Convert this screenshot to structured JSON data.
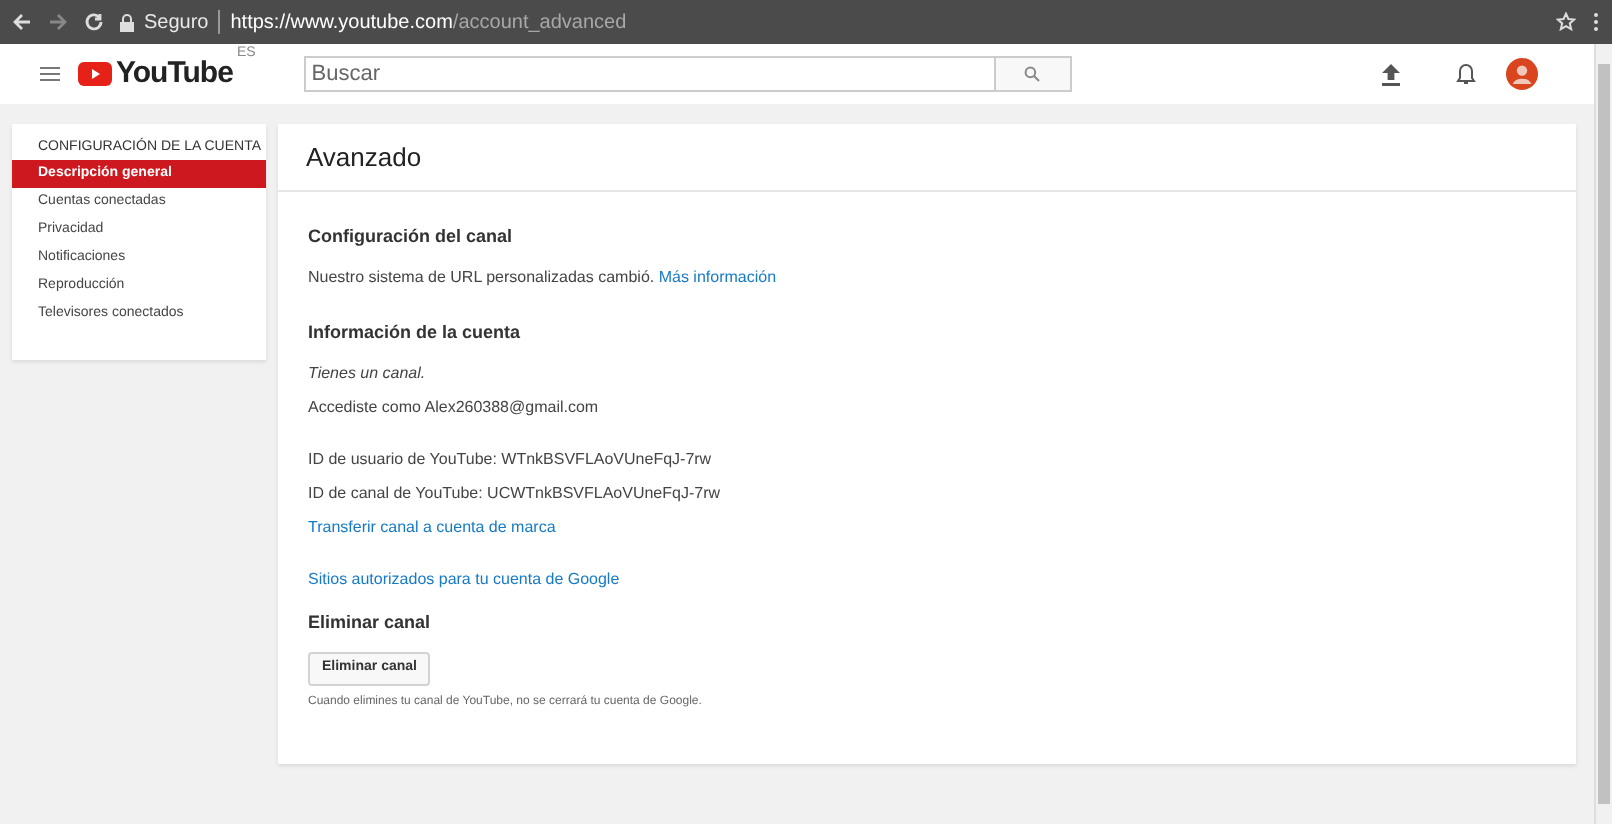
{
  "browser": {
    "security": "Seguro",
    "url_host": "https://www.youtube.com",
    "url_path": "/account_advanced"
  },
  "header": {
    "logo": "YouTube",
    "region": "ES",
    "search": {
      "placeholder": "Buscar"
    }
  },
  "sidebar": {
    "title": "CONFIGURACIÓN DE LA CUENTA",
    "items": [
      {
        "label": "Descripción general",
        "selected": true
      },
      {
        "label": "Cuentas conectadas",
        "selected": false
      },
      {
        "label": "Privacidad",
        "selected": false
      },
      {
        "label": "Notificaciones",
        "selected": false
      },
      {
        "label": "Reproducción",
        "selected": false
      },
      {
        "label": "Televisores conectados",
        "selected": false
      }
    ]
  },
  "main": {
    "title": "Avanzado",
    "sections": [
      {
        "heading": "Configuración del canal",
        "blocks": [
          [
            {
              "kind": "text_link",
              "text": "Nuestro sistema de URL personalizadas cambió.",
              "link": "Más información"
            }
          ]
        ]
      },
      {
        "heading": "Información de la cuenta",
        "blocks": [
          [
            {
              "kind": "italic",
              "text": "Tienes un canal."
            },
            {
              "kind": "text",
              "text": "Accediste como Alex260388@gmail.com"
            }
          ],
          [
            {
              "kind": "text",
              "text": "ID de usuario de YouTube: WTnkBSVFLAoVUneFqJ-7rw"
            },
            {
              "kind": "text",
              "text": "ID de canal de YouTube: UCWTnkBSVFLAoVUneFqJ-7rw"
            },
            {
              "kind": "link",
              "text": "Transferir canal a cuenta de marca"
            }
          ],
          [
            {
              "kind": "link",
              "text": "Sitios autorizados para tu cuenta de Google"
            }
          ]
        ]
      },
      {
        "heading": "Eliminar canal",
        "blocks": [
          [
            {
              "kind": "button",
              "text": "Eliminar canal"
            },
            {
              "kind": "note",
              "text": "Cuando elimines tu canal de YouTube, no se cerrará tu cuenta de Google."
            }
          ]
        ]
      }
    ]
  }
}
